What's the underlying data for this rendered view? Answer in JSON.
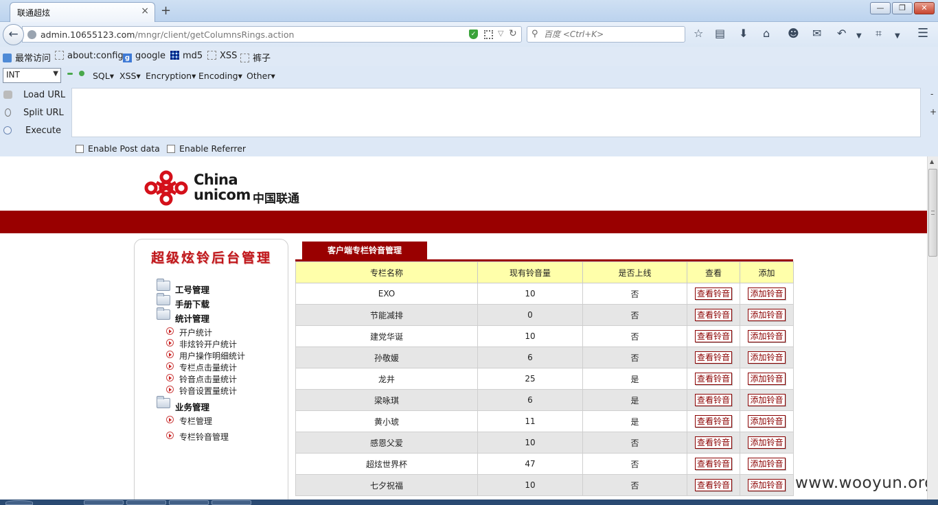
{
  "browser": {
    "tab_title": "联通超炫",
    "tab_close": "×",
    "new_tab": "+",
    "window_controls": {
      "minimize": "—",
      "maximize": "❐",
      "close": "✕"
    },
    "url_host": "admin.10655123.com",
    "url_path": "/mngr/client/getColumnsRings.action",
    "search_placeholder": "百度 <Ctrl+K>",
    "icons": [
      "back-icon",
      "globe-icon",
      "shield-icon",
      "qrcode-icon",
      "reload-icon",
      "search-icon",
      "bookmark-star-icon",
      "reading-list-icon",
      "download-icon",
      "home-icon",
      "emoji-icon",
      "chat-icon",
      "undo-icon",
      "crop-icon",
      "menu-icon"
    ]
  },
  "bookmarks": {
    "items": [
      {
        "label": "最常访问",
        "icon": "bookmark-folder-icon"
      },
      {
        "label": "about:config",
        "icon": "page-icon"
      },
      {
        "label": "google",
        "icon": "google-icon"
      },
      {
        "label": "md5",
        "icon": "grid-icon"
      },
      {
        "label": "XSS",
        "icon": "page-icon"
      },
      {
        "label": "裤子",
        "icon": "page-icon"
      }
    ]
  },
  "hackbar": {
    "type_select": "INT",
    "menus": [
      "SQL",
      "XSS",
      "Encryption",
      "Encoding",
      "Other"
    ],
    "actions": [
      "Load URL",
      "Split URL",
      "Execute"
    ],
    "minus": "-",
    "plus": "+",
    "enable_post": "Enable Post data",
    "enable_referrer": "Enable Referrer"
  },
  "page": {
    "logo_line1": "China",
    "logo_line2": "unicom",
    "logo_cn": "中国联通",
    "sidebar_title": "超级炫铃后台管理",
    "menu": {
      "group1": "工号管理",
      "group2": "手册下载",
      "group3": "统计管理",
      "group3_items": [
        "开户统计",
        "非炫铃开户统计",
        "用户操作明细统计",
        "专栏点击量统计",
        "铃音点击量统计",
        "铃音设置量统计"
      ],
      "group4": "业务管理",
      "group4_items": [
        "专栏管理",
        "专栏铃音管理"
      ]
    },
    "panel_title": "客户端专栏铃音管理",
    "table": {
      "headers": [
        "专栏名称",
        "现有铃音量",
        "是否上线",
        "查看",
        "添加"
      ],
      "view_label": "查看铃音",
      "add_label": "添加铃音",
      "rows": [
        {
          "name": "EXO",
          "count": "10",
          "online": "否"
        },
        {
          "name": "节能减排",
          "count": "0",
          "online": "否"
        },
        {
          "name": "建党华诞",
          "count": "10",
          "online": "否"
        },
        {
          "name": "孙敬媛",
          "count": "6",
          "online": "否"
        },
        {
          "name": "龙井",
          "count": "25",
          "online": "是"
        },
        {
          "name": "梁咏琪",
          "count": "6",
          "online": "是"
        },
        {
          "name": "黄小琥",
          "count": "11",
          "online": "是"
        },
        {
          "name": "感恩父爱",
          "count": "10",
          "online": "否"
        },
        {
          "name": "超炫世界杯",
          "count": "47",
          "online": "否"
        },
        {
          "name": "七夕祝福",
          "count": "10",
          "online": "否"
        }
      ]
    },
    "watermark": "www.wooyun.org"
  },
  "colors": {
    "brand_red": "#990000",
    "header_yellow": "#ffffaa",
    "row_gray": "#e6e6e6"
  }
}
